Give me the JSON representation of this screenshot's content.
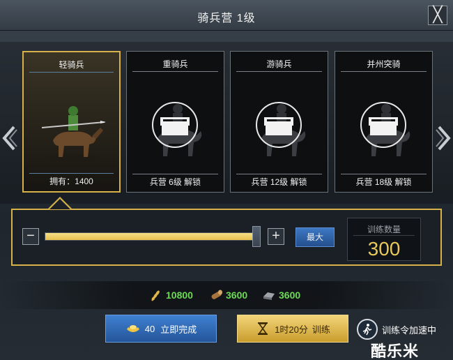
{
  "title": "骑兵营 1级",
  "close_label": "╳",
  "nav": {
    "left_arrow": "‹",
    "right_arrow": "›"
  },
  "units": [
    {
      "name": "轻骑兵",
      "footer": "拥有：1400",
      "selected": true,
      "locked": false
    },
    {
      "name": "重骑兵",
      "footer": "兵营 6级 解锁",
      "selected": false,
      "locked": true
    },
    {
      "name": "游骑兵",
      "footer": "兵营 12级 解锁",
      "selected": false,
      "locked": true
    },
    {
      "name": "并州突骑",
      "footer": "兵营 18级 解锁",
      "selected": false,
      "locked": true
    }
  ],
  "train": {
    "minus_label": "−",
    "plus_label": "+",
    "slider_fraction": 1.0,
    "max_label": "最大",
    "count_label": "训练数量",
    "count_value": "300"
  },
  "resources": [
    {
      "icon": "wheat-icon",
      "value": "10800"
    },
    {
      "icon": "wood-icon",
      "value": "3600"
    },
    {
      "icon": "iron-icon",
      "value": "3600"
    }
  ],
  "actions": {
    "instant_cost": "40",
    "instant_label": "立即完成",
    "train_time": "1时20分",
    "train_label": "训练"
  },
  "speed_up": {
    "label": "训练令加速中"
  },
  "watermark": "酷乐米",
  "colors": {
    "gold": "#d7b24a",
    "green": "#6bdc54",
    "blue": "#3f80d0"
  }
}
